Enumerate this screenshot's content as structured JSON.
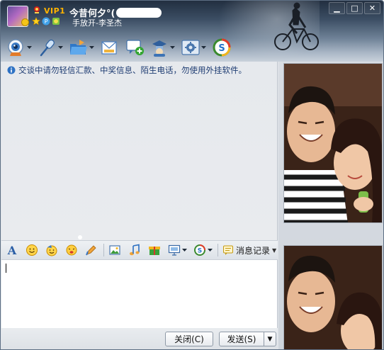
{
  "window": {
    "nickname": "今昔何夕°(",
    "vip_label": "VIP1",
    "signature": "手放开-李圣杰",
    "controls": {
      "minimize": "▁",
      "maximize": "□",
      "close": "✕"
    }
  },
  "toolbar": {
    "items": [
      {
        "icon": "video-call-icon",
        "has_dropdown": true
      },
      {
        "icon": "voice-call-icon",
        "has_dropdown": true
      },
      {
        "icon": "send-file-icon",
        "has_dropdown": true
      },
      {
        "icon": "email-icon",
        "has_dropdown": false
      },
      {
        "icon": "create-discussion-icon",
        "has_dropdown": false
      },
      {
        "icon": "remote-assist-icon",
        "has_dropdown": true
      },
      {
        "icon": "app-settings-icon",
        "has_dropdown": true
      },
      {
        "icon": "soso-icon",
        "has_dropdown": false
      }
    ]
  },
  "chat": {
    "notice": "交谈中请勿轻信汇款、中奖信息、陌生电话，勿使用外挂软件。"
  },
  "input_toolbar": {
    "items": [
      "font-icon",
      "emoji-icon",
      "magic-emoji-icon",
      "shake-window-icon",
      "doodle-icon",
      "send-image-icon",
      "music-icon",
      "gift-icon",
      "screen-capture-icon",
      "soso-icon"
    ],
    "history_label": "消息记录"
  },
  "input": {
    "value": ""
  },
  "buttons": {
    "close": "关闭(C)",
    "send": "发送(S)",
    "send_more": "▼"
  },
  "colors": {
    "title_dark": "#222f40",
    "title_light": "#c9d1db",
    "vip_gold": "#ffb300",
    "notice_text": "#1e3c72"
  }
}
